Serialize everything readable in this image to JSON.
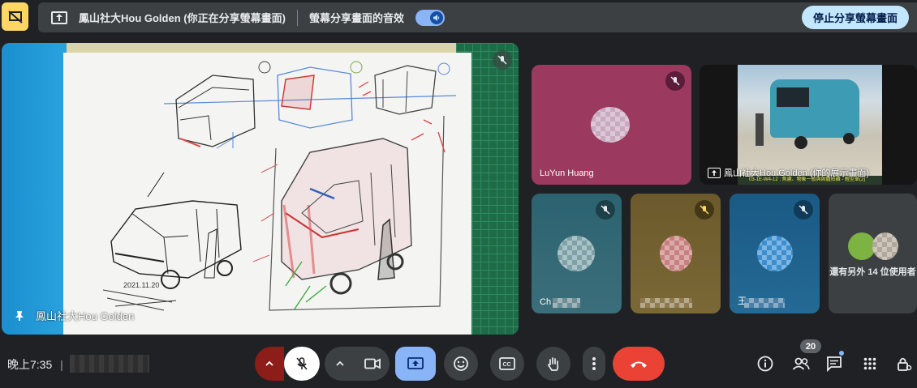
{
  "banner": {
    "presenter_text": "鳳山社大Hou Golden (你正在分享螢幕畫面)",
    "audio_label": "螢幕分享畫面的音效",
    "audio_on": true,
    "stop_button": "停止分享螢幕畫面"
  },
  "main_tile": {
    "name": "鳳山社大Hou Golden",
    "sketch_date": "2021.11.20"
  },
  "tiles": [
    {
      "name": "LuYun Huang",
      "muted": true,
      "bg": "#9b3a5e"
    },
    {
      "name": "鳳山社大Hou Golden (你的展示畫面)",
      "caption": "03-1E-W4-12 : 焦慮、物象一般與固體拍攝 - 輕型車(2)",
      "muted": false
    },
    {
      "name": "Ch",
      "muted": true,
      "bg": "#2f5f6d"
    },
    {
      "name": "",
      "muted": true,
      "bg": "#6b5a2f"
    },
    {
      "name": "王",
      "muted": true,
      "bg": "#1c5d87"
    },
    {
      "name": "還有另外 14 位使用者",
      "muted": false,
      "bg": "#3c4043"
    }
  ],
  "bottom": {
    "time": "晚上7:35",
    "separator": "|",
    "people_count": "20"
  },
  "colors": {
    "end_call": "#ea4335",
    "mic_off_bg": "#8c1d18",
    "present_active": "#8ab4f8",
    "control_bg": "#3c4043"
  },
  "icons": [
    "share-off-icon",
    "present-screen-icon",
    "volume-icon",
    "mic-off-icon",
    "chevron-up-icon",
    "videocam-icon",
    "present-to-all-icon",
    "emoji-icon",
    "captions-icon",
    "raise-hand-icon",
    "more-vert-icon",
    "call-end-icon",
    "info-icon",
    "people-icon",
    "chat-icon",
    "apps-icon",
    "host-controls-icon",
    "pin-icon"
  ]
}
